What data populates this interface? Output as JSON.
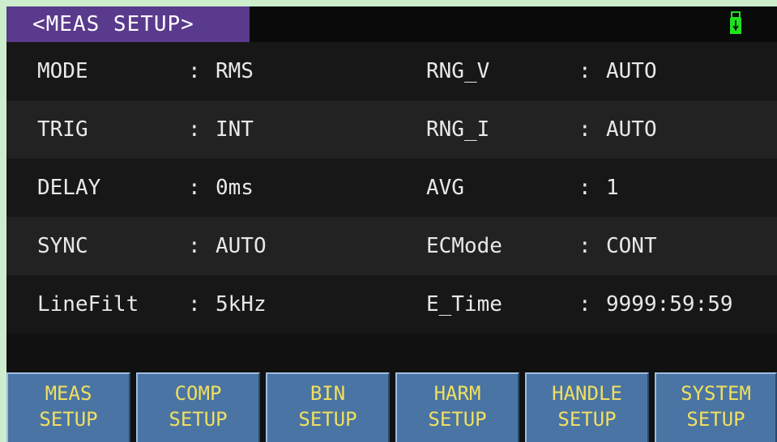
{
  "header": {
    "title": "<MEAS SETUP>",
    "usb_icon": "usb-drive-icon",
    "usb_color": "#20e020"
  },
  "rows": [
    {
      "label1": "MODE",
      "colon1": ":",
      "value1": "RMS",
      "label2": "RNG_V",
      "colon2": ":",
      "value2": "AUTO"
    },
    {
      "label1": "TRIG",
      "colon1": ":",
      "value1": "INT",
      "label2": "RNG_I",
      "colon2": ":",
      "value2": "AUTO"
    },
    {
      "label1": "DELAY",
      "colon1": ":",
      "value1": "0ms",
      "label2": "AVG",
      "colon2": ":",
      "value2": "1"
    },
    {
      "label1": "SYNC",
      "colon1": ":",
      "value1": "AUTO",
      "label2": "ECMode",
      "colon2": ":",
      "value2": "CONT"
    },
    {
      "label1": "LineFilt",
      "colon1": ":",
      "value1": "5kHz",
      "label2": "E_Time",
      "colon2": ":",
      "value2": "9999:59:59"
    }
  ],
  "softkeys": [
    {
      "line1": "MEAS",
      "line2": "SETUP"
    },
    {
      "line1": "COMP",
      "line2": "SETUP"
    },
    {
      "line1": "BIN",
      "line2": "SETUP"
    },
    {
      "line1": "HARM",
      "line2": "SETUP"
    },
    {
      "line1": "HANDLE",
      "line2": "SETUP"
    },
    {
      "line1": "SYSTEM",
      "line2": "SETUP"
    }
  ],
  "colors": {
    "title_bg": "#5a3a8c",
    "softkey_bg": "#4a74a4",
    "softkey_text": "#f0e060",
    "frame": "#cdeecd"
  }
}
